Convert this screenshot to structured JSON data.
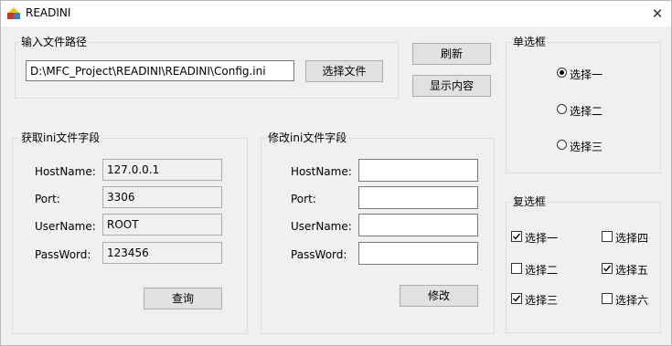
{
  "window": {
    "title": "READINI",
    "close_glyph": "✕"
  },
  "file_group": {
    "title": "输入文件路径",
    "path_value": "D:\\MFC_Project\\READINI\\READINI\\Config.ini",
    "select_button": "选择文件"
  },
  "actions": {
    "refresh": "刷新",
    "show_content": "显示内容"
  },
  "read_group": {
    "title": "获取ini文件字段",
    "fields": [
      {
        "label": "HostName:",
        "value": "127.0.0.1"
      },
      {
        "label": "Port:",
        "value": "3306"
      },
      {
        "label": "UserName:",
        "value": "ROOT"
      },
      {
        "label": "PassWord:",
        "value": "123456"
      }
    ],
    "query_button": "查询"
  },
  "edit_group": {
    "title": "修改ini文件字段",
    "fields": [
      {
        "label": "HostName:",
        "value": ""
      },
      {
        "label": "Port:",
        "value": ""
      },
      {
        "label": "UserName:",
        "value": ""
      },
      {
        "label": "PassWord:",
        "value": ""
      }
    ],
    "modify_button": "修改"
  },
  "radio_group": {
    "title": "单选框",
    "options": [
      {
        "label": "选择一",
        "selected": true
      },
      {
        "label": "选择二",
        "selected": false
      },
      {
        "label": "选择三",
        "selected": false
      }
    ]
  },
  "check_group": {
    "title": "复选框",
    "options": [
      {
        "label": "选择一",
        "checked": true
      },
      {
        "label": "选择二",
        "checked": false
      },
      {
        "label": "选择三",
        "checked": true
      },
      {
        "label": "选择四",
        "checked": false
      },
      {
        "label": "选择五",
        "checked": true
      },
      {
        "label": "选择六",
        "checked": false
      }
    ]
  }
}
